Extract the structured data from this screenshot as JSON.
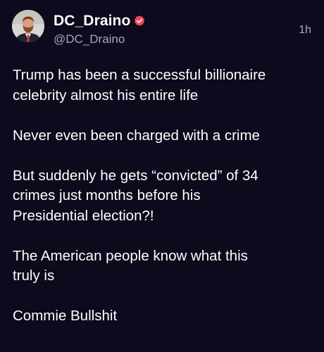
{
  "post": {
    "display_name": "DC_Draino",
    "handle": "@DC_Draino",
    "timestamp": "1h",
    "verified_color": "#f24957",
    "paragraphs": [
      "Trump has been a successful billionaire\ncelebrity almost his entire life",
      "Never even been charged with a crime",
      "But suddenly he gets “convicted” of 34\ncrimes just months before his\nPresidential election?!",
      "The American people know what this\ntruly is",
      "Commie Bullshit"
    ]
  },
  "icons": {
    "verified": "verified-badge-icon",
    "avatar": "profile-photo"
  }
}
